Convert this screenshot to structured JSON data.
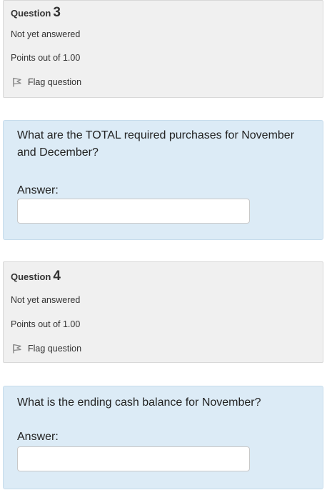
{
  "questions": [
    {
      "heading_label": "Question",
      "number": "3",
      "status": "Not yet answered",
      "points": "Points out of 1.00",
      "flag_label": "Flag question",
      "text": "What are the TOTAL required purchases for November and December?",
      "answer_label": "Answer:",
      "answer_value": ""
    },
    {
      "heading_label": "Question",
      "number": "4",
      "status": "Not yet answered",
      "points": "Points out of 1.00",
      "flag_label": "Flag question",
      "text": "What is the ending cash balance for November?",
      "answer_label": "Answer:",
      "answer_value": ""
    }
  ],
  "colors": {
    "info_bg": "#f0f0f0",
    "content_bg": "#dcebf6",
    "text": "#333333"
  },
  "icons": {
    "flag": "flag-icon"
  }
}
